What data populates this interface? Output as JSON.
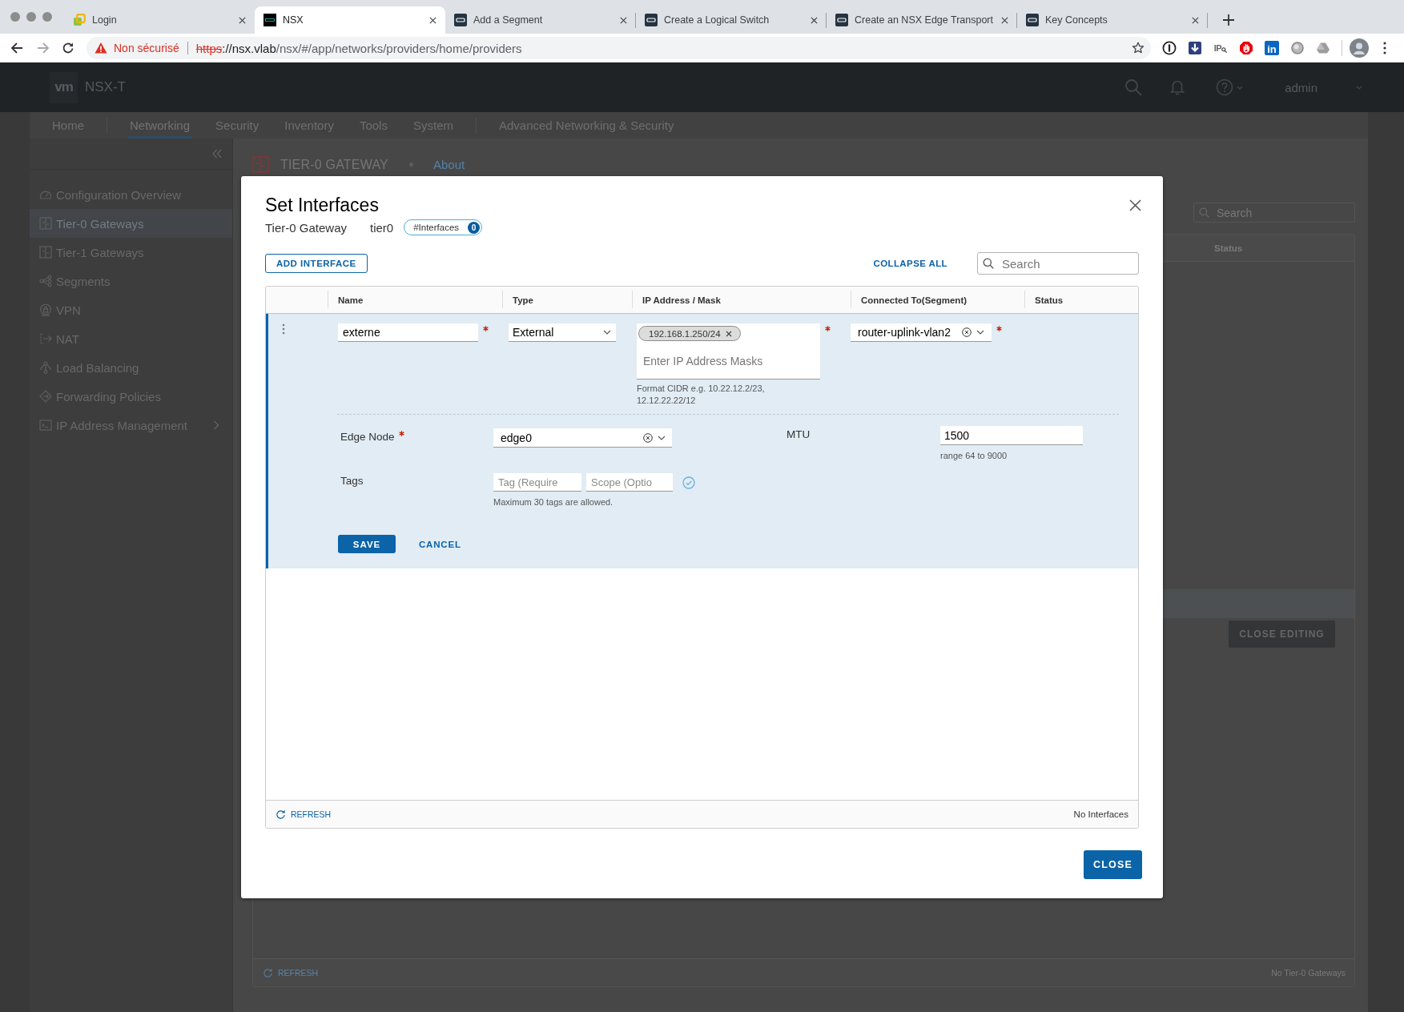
{
  "browser": {
    "tabs": [
      {
        "title": "Login",
        "selected": false
      },
      {
        "title": "NSX",
        "selected": true
      },
      {
        "title": "Add a Segment",
        "selected": false
      },
      {
        "title": "Create a Logical Switch",
        "selected": false
      },
      {
        "title": "Create an NSX Edge Transport",
        "selected": false
      },
      {
        "title": "Key Concepts",
        "selected": false
      }
    ],
    "address_bar": {
      "security": "Non sécurisé",
      "scheme": "https",
      "host": "://nsx.vlab",
      "path": "/nsx/#/app/networks/providers/home/providers"
    },
    "extensions": [
      {
        "kind": "ring"
      },
      {
        "kind": "download"
      },
      {
        "kind": "ip",
        "text": "IP"
      },
      {
        "kind": "stop"
      },
      {
        "kind": "tile",
        "text": "in"
      },
      {
        "kind": "sphere"
      },
      {
        "kind": "triangle"
      }
    ]
  },
  "app_header": {
    "logo": "vm",
    "product": "NSX-T",
    "user": "admin"
  },
  "nav": {
    "sections": [
      {
        "items": [
          {
            "label": "Home",
            "selected": false
          }
        ]
      },
      {
        "items": [
          {
            "label": "Networking",
            "selected": true
          },
          {
            "label": "Security",
            "selected": false
          },
          {
            "label": "Inventory",
            "selected": false
          },
          {
            "label": "Tools",
            "selected": false
          },
          {
            "label": "System",
            "selected": false
          }
        ]
      },
      {
        "items": [
          {
            "label": "Advanced Networking & Security",
            "selected": false
          }
        ]
      }
    ]
  },
  "sidebar": {
    "items": [
      {
        "label": "Configuration Overview",
        "kind": "page",
        "selected": false
      },
      {
        "label": "Tier-0 Gateways",
        "kind": "page",
        "selected": true
      },
      {
        "label": "Tier-1 Gateways",
        "kind": "page",
        "selected": false
      },
      {
        "label": "Segments",
        "kind": "page",
        "selected": false
      },
      {
        "label": "VPN",
        "kind": "page",
        "selected": false
      },
      {
        "label": "NAT",
        "kind": "page",
        "selected": false
      },
      {
        "label": "Load Balancing",
        "kind": "page",
        "selected": false
      },
      {
        "label": "Forwarding Policies",
        "kind": "page",
        "selected": false
      },
      {
        "label": "IP Address Management",
        "kind": "group",
        "expanded": false,
        "selected": false
      }
    ]
  },
  "page": {
    "title": "TIER-0 GATEWAY",
    "link": "About",
    "search": {
      "placeholder": "Search"
    },
    "table": {
      "columns": [
        "Status"
      ],
      "action": "CLOSE EDITING",
      "footer": {
        "refresh": "REFRESH",
        "count": "No Tier-0 Gateways"
      }
    }
  },
  "dialog": {
    "title": "Set Interfaces",
    "subtitle": {
      "label": "Tier-0 Gateway",
      "value": "tier0",
      "badge": {
        "label": "#Interfaces",
        "count": "0"
      }
    },
    "add_button": "ADD INTERFACE",
    "collapse_button": "COLLAPSE ALL",
    "search": {
      "placeholder": "Search"
    },
    "table": {
      "columns": [
        "Name",
        "Type",
        "IP Address / Mask",
        "Connected To(Segment)",
        "Status"
      ],
      "rows": [
        {
          "expanded": true,
          "name": {
            "value": "externe",
            "required": true
          },
          "type": {
            "value": "External"
          },
          "ip": {
            "tags": [
              "192.168.1.250/24"
            ],
            "placeholder": "Enter IP Address Masks",
            "hint": "Format CIDR e.g. 10.22.12.2/23, 12.12.22.22/12",
            "required": true
          },
          "segment": {
            "value": "router-uplink-vlan2",
            "required": true
          },
          "details": {
            "edge_node": {
              "label": "Edge Node",
              "value": "edge0",
              "required": true
            },
            "mtu": {
              "label": "MTU",
              "value": "1500",
              "hint": "range 64 to 9000"
            },
            "tags": {
              "label": "Tags",
              "tag_placeholder": "Tag (Require",
              "scope_placeholder": "Scope (Optio",
              "hint": "Maximum 30 tags are allowed."
            },
            "save": "SAVE",
            "cancel": "CANCEL"
          }
        }
      ],
      "footer": {
        "refresh": "REFRESH",
        "count": "No Interfaces"
      }
    },
    "close_button": "CLOSE"
  }
}
